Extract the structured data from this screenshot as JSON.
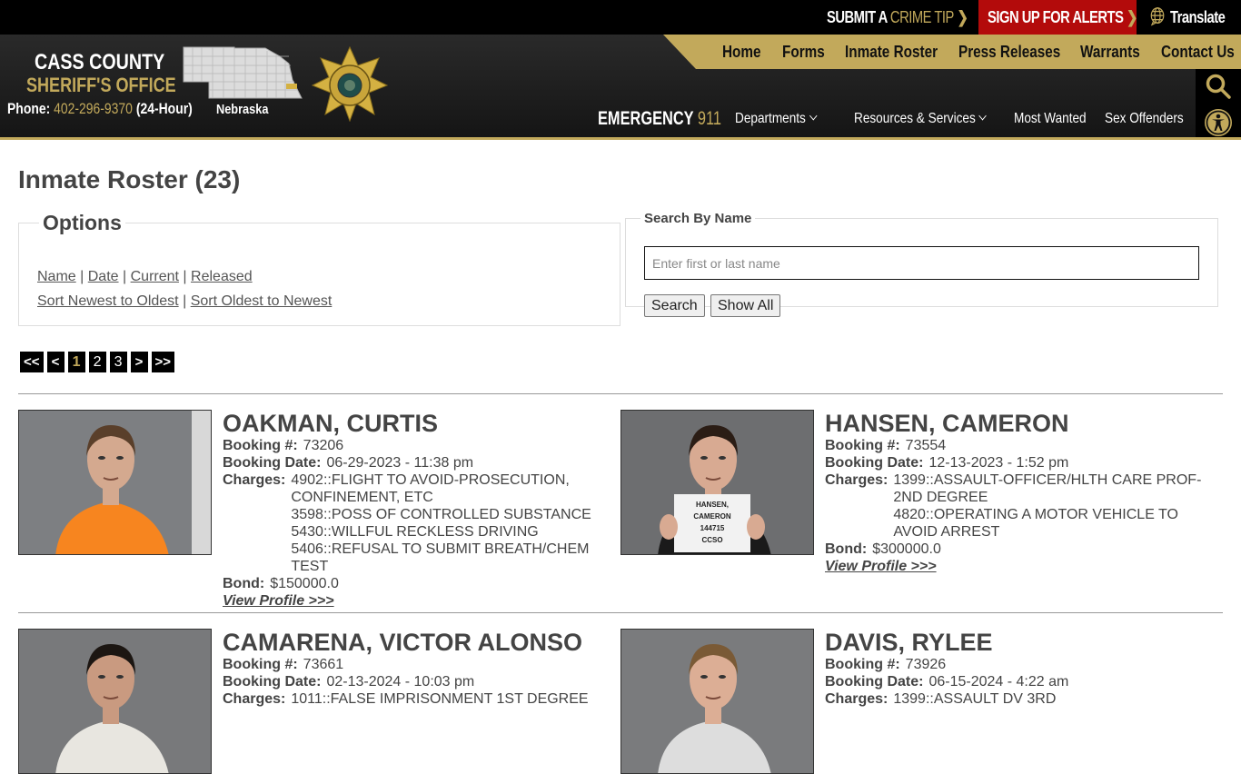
{
  "topbar": {
    "crime_tip_prefix": "SUBMIT A ",
    "crime_tip_gold": "CRIME TIP",
    "alerts": "SIGN UP FOR ALERTS",
    "translate": "Translate",
    "chevron": "❯"
  },
  "header": {
    "brand_line1": "CASS COUNTY",
    "brand_line2": "SHERIFF'S OFFICE",
    "phone_label": "Phone:",
    "phone_number": "402-296-9370",
    "phone_suffix": "(24-Hour)",
    "map_label": "Nebraska",
    "emergency_label": "EMERGENCY",
    "emergency_number": "911"
  },
  "main_nav": [
    "Home",
    "Forms",
    "Inmate Roster",
    "Press Releases",
    "Warrants",
    "Contact Us"
  ],
  "sub_nav": [
    {
      "label": "Departments",
      "dropdown": true
    },
    {
      "label": "Resources & Services",
      "dropdown": true
    },
    {
      "label": "Most Wanted",
      "dropdown": false
    },
    {
      "label": "Sex Offenders",
      "dropdown": false
    }
  ],
  "icons": {
    "search": "search-icon",
    "accessibility": "accessibility-icon",
    "globe": "globe-icon"
  },
  "colors": {
    "gold": "#c2a95b",
    "alert_red": "#b30b0b",
    "dark": "#151515"
  },
  "page": {
    "title": "Inmate Roster (23)",
    "options": {
      "legend": "Options",
      "filters": [
        "Name",
        "Date",
        "Current",
        "Released"
      ],
      "sorts": [
        "Sort Newest to Oldest",
        "Sort Oldest to Newest"
      ],
      "separator": "|"
    },
    "search": {
      "legend": "Search By Name",
      "placeholder": "Enter first or last name",
      "value": "",
      "search_button": "Search",
      "show_all_button": "Show All"
    },
    "pagination": {
      "first": "<<",
      "prev": "<",
      "pages": [
        "1",
        "2",
        "3"
      ],
      "current": "1",
      "next": ">",
      "last": ">>"
    }
  },
  "labels": {
    "booking_num": "Booking #:",
    "booking_date": "Booking Date:",
    "charges": "Charges:",
    "bond": "Bond:",
    "view_profile": "View Profile >>>"
  },
  "inmates": [
    {
      "name": "OAKMAN, CURTIS",
      "booking_num": "73206",
      "booking_date": "06-29-2023 - 11:38 pm",
      "charges": [
        "4902::FLIGHT TO AVOID-PROSECUTION, CONFINEMENT, ETC",
        "3598::POSS OF CONTROLLED SUBSTANCE",
        "5430::WILLFUL RECKLESS DRIVING",
        "5406::REFUSAL TO SUBMIT BREATH/CHEM TEST"
      ],
      "bond": "$150000.0",
      "photo": {
        "bg": "#7d7f82",
        "shirt": "#f7851f",
        "hair": "#5a3f2a",
        "skin": "#d4a98f"
      }
    },
    {
      "name": "HANSEN, CAMERON",
      "booking_num": "73554",
      "booking_date": "12-13-2023 - 1:52 pm",
      "charges": [
        "1399::ASSAULT-OFFICER/HLTH CARE PROF-2ND DEGREE",
        "4820::OPERATING A MOTOR VEHICLE TO AVOID ARREST"
      ],
      "bond": "$300000.0",
      "photo": {
        "bg": "#6d6e70",
        "shirt": "#1a1a1a",
        "hair": "#2b1d15",
        "skin": "#d8aa92",
        "sign": [
          "HANSEN,",
          "CAMERON",
          "144715",
          "CCSO"
        ]
      }
    },
    {
      "name": "CAMARENA, VICTOR ALONSO",
      "booking_num": "73661",
      "booking_date": "02-13-2024 - 10:03 pm",
      "charges": [
        "1011::FALSE IMPRISONMENT 1ST DEGREE"
      ],
      "photo": {
        "bg": "#78797b",
        "shirt": "#e8e6e0",
        "hair": "#1c1612",
        "skin": "#c99a80"
      }
    },
    {
      "name": "DAVIS, RYLEE",
      "booking_num": "73926",
      "booking_date": "06-15-2024 - 4:22 am",
      "charges": [
        "1399::ASSAULT DV 3RD"
      ],
      "photo": {
        "bg": "#7a7b7d",
        "shirt": "#ddd",
        "hair": "#7a5a36",
        "skin": "#dcae95"
      }
    }
  ]
}
